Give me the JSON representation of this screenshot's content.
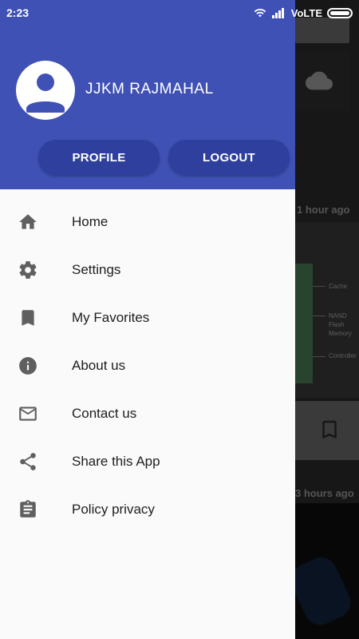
{
  "status_bar": {
    "time": "2:23",
    "network": "VoLTE"
  },
  "drawer": {
    "user_name": "JJKM RAJMAHAL",
    "profile_button": "PROFILE",
    "logout_button": "LOGOUT",
    "items": [
      {
        "label": "Home",
        "icon": "home-icon"
      },
      {
        "label": "Settings",
        "icon": "gear-icon"
      },
      {
        "label": "My Favorites",
        "icon": "bookmark-icon"
      },
      {
        "label": "About us",
        "icon": "info-icon"
      },
      {
        "label": "Contact us",
        "icon": "mail-icon"
      },
      {
        "label": "Share this App",
        "icon": "share-icon"
      },
      {
        "label": "Policy privacy",
        "icon": "clipboard-icon"
      }
    ]
  },
  "background": {
    "time_1": "1 hour ago",
    "time_2": "3 hours ago",
    "chip_labels": [
      "Cache",
      "NAND Flash Memory",
      "Controller"
    ]
  },
  "colors": {
    "header": "#3f51b5",
    "header_button": "#2f3f9e",
    "drawer_bg": "#fafafa",
    "icon": "#5f5f5f"
  }
}
